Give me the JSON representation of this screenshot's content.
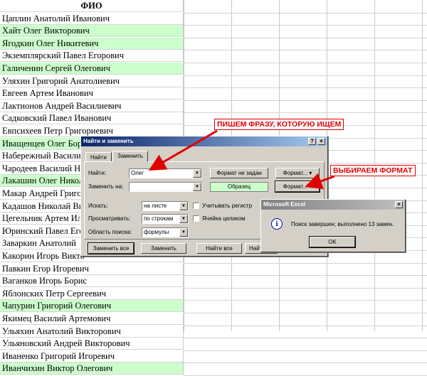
{
  "sheet": {
    "header": "ФИО",
    "rows": [
      {
        "name": "Цаплин Анатолий Иванович",
        "hl": false
      },
      {
        "name": "Хайт Олег Викторович",
        "hl": true
      },
      {
        "name": "Ягодкин Олег Никитевич",
        "hl": true
      },
      {
        "name": "Экземплярский Павел Егорович",
        "hl": false
      },
      {
        "name": "Галиченин Сергей Олегович",
        "hl": true
      },
      {
        "name": "Уляхин Григорий Анатолиевич",
        "hl": false
      },
      {
        "name": "Евгеев Артем Иванович",
        "hl": false
      },
      {
        "name": "Лактионов Андрей Василиевич",
        "hl": false
      },
      {
        "name": "Садковский Павел Иванович",
        "hl": false
      },
      {
        "name": "Евпсихеев Петр Григориевич",
        "hl": false
      },
      {
        "name": "Иващенцев Олег Борисович",
        "hl": true
      },
      {
        "name": "Набережный Василий",
        "hl": false
      },
      {
        "name": "Чародеев Василий Ни",
        "hl": false
      },
      {
        "name": "Лакашин Олег Никола",
        "hl": true
      },
      {
        "name": "Макар Андрей Григор",
        "hl": false
      },
      {
        "name": "Кадашов Николай Вик",
        "hl": false
      },
      {
        "name": "Цегельник Артем Иль",
        "hl": false
      },
      {
        "name": "Юринский Павел Егор",
        "hl": false
      },
      {
        "name": "Заваркин Анатолий",
        "hl": false
      },
      {
        "name": "Какорин Игорь Викто",
        "hl": false
      },
      {
        "name": "Павкин Егор Игоревич",
        "hl": false
      },
      {
        "name": "Ваганков Игорь Борис",
        "hl": false
      },
      {
        "name": "Яблонских Петр Сергеевич",
        "hl": false
      },
      {
        "name": "Чапурин Григорий Олегович",
        "hl": true
      },
      {
        "name": "Якимец Василий Артемович",
        "hl": false
      },
      {
        "name": "Ульяхин Анатолий Викторович",
        "hl": false
      },
      {
        "name": "Ульяновский Андрей Викторович",
        "hl": false
      },
      {
        "name": "Иваненко Григорий Игоревич",
        "hl": false
      },
      {
        "name": "Иванчихин Виктор Олегович",
        "hl": true
      }
    ]
  },
  "find_replace": {
    "title": "Найти и заменить",
    "help": "?",
    "close": "×",
    "tab_find": "Найти",
    "tab_replace": "Заменить",
    "find_label": "Найти:",
    "find_value": "Олег",
    "replace_label": "Заменить на:",
    "replace_value": "",
    "format_not_set": "Формат не задан",
    "format_btn": "Формат...",
    "preview": "Образец",
    "format_btn2": "Формат...",
    "search_label": "Искать:",
    "search_value": "на листе",
    "browse_label": "Просматривать:",
    "browse_value": "по строкам",
    "area_label": "Область поиска:",
    "area_value": "формулы",
    "match_case": "Учитывать регистр",
    "whole_cell": "Ячейка целиком",
    "replace_all": "Заменить все",
    "replace": "Заменить",
    "find_all": "Найти все",
    "find_next": "Найти д"
  },
  "msgbox": {
    "title": "Microsoft Excel",
    "close": "×",
    "icon": "i",
    "text": "Поиск завершен; выполнено 13 замен.",
    "ok": "OK"
  },
  "annotations": {
    "phrase": "ПИШЕМ ФРАЗУ, КОТОРУЮ ИЩЕМ",
    "format": "ВЫБИРАЕМ ФОРМАТ"
  },
  "colors": {
    "highlight": "#ccffcc",
    "arrow": "#e00000",
    "title_active": "#0a246a"
  }
}
